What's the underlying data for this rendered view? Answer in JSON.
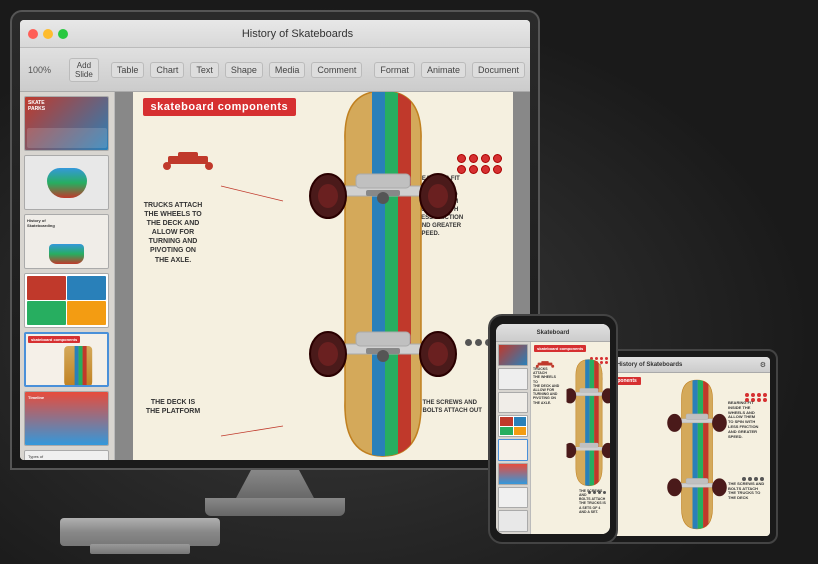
{
  "app": {
    "title": "History of Skateboards",
    "toolbar": {
      "buttons": [
        "Table",
        "Chart",
        "Text",
        "Shape",
        "Media",
        "Comment"
      ]
    },
    "slide_title": "skateboard components",
    "labels": {
      "trucks": "TRUCKS ATTACH\nTHE WHEELS TO\nTHE DECK AND\nALLOW FOR\nTURNING AND\nPIVOTING ON\nTHE AXLE.",
      "bearings": "BEARINGS FIT\nINSIDE THE\nWHEELS AND\nALLOW THEM\nTO SPIN WITH\nLESS FRICTION\nAND GREATER\nSPEED.",
      "deck": "THE DECK IS\nTHE PLATFORM",
      "screws": "THE SCREWS AND\nBOLTS ATTACH OUT"
    },
    "toolbar_right": [
      "Format",
      "Animate",
      "Document"
    ],
    "zoom": "100%"
  },
  "slides": [
    {
      "id": 1,
      "active": false
    },
    {
      "id": 2,
      "active": false
    },
    {
      "id": 3,
      "active": false
    },
    {
      "id": 4,
      "active": false
    },
    {
      "id": 5,
      "active": true
    },
    {
      "id": 6,
      "active": false
    },
    {
      "id": 7,
      "active": false
    },
    {
      "id": 8,
      "active": false
    }
  ],
  "tablet": {
    "title": "History of Skateboards"
  },
  "phone": {
    "title": "Skateboard"
  }
}
